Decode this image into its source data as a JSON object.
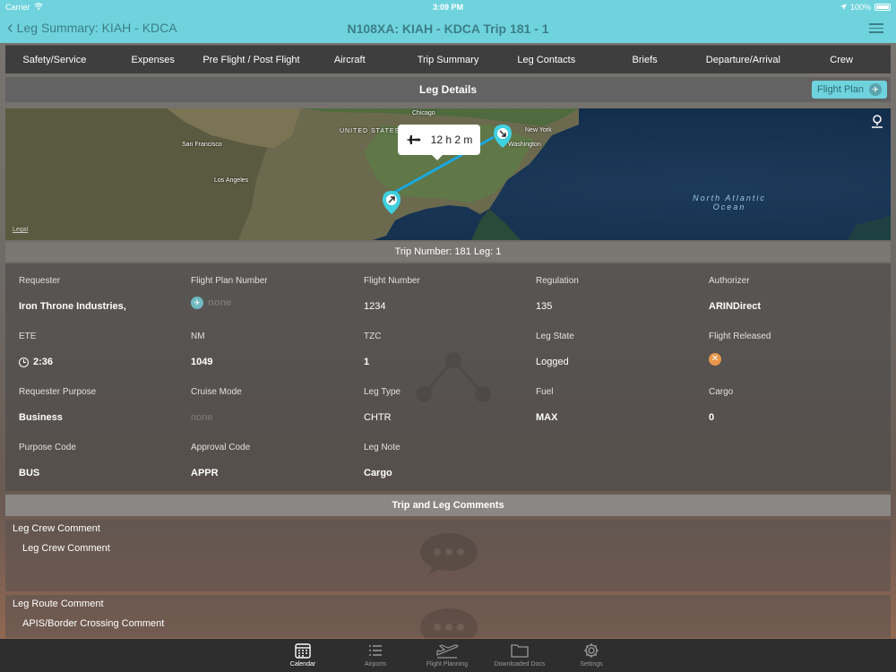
{
  "status": {
    "carrier": "Carrier",
    "time": "3:09 PM",
    "battery": "100%"
  },
  "nav": {
    "back_label": "Leg Summary: KIAH - KDCA",
    "title": "N108XA: KIAH - KDCA  Trip 181 - 1"
  },
  "tabs": [
    "Safety/Service",
    "Expenses",
    "Pre Flight / Post Flight",
    "Aircraft",
    "Trip Summary",
    "Leg Contacts",
    "Briefs",
    "Departure/Arrival",
    "Crew"
  ],
  "leg_details": {
    "title": "Leg Details",
    "flight_plan_label": "Flight Plan"
  },
  "map": {
    "labels": {
      "chicago": "Chicago",
      "san_francisco": "San Francisco",
      "los_angeles": "Los Angeles",
      "new_york": "New York",
      "washington": "Washington",
      "united_states": "UNITED STATES"
    },
    "ocean_line1": "North Atlantic",
    "ocean_line2": "Ocean",
    "duration": "12 h 2 m",
    "legal": "Legal"
  },
  "trip_bar": "Trip Number:  181  Leg:  1",
  "fields": {
    "requester": {
      "label": "Requester",
      "value": "Iron Throne Industries,"
    },
    "flight_plan_number": {
      "label": "Flight Plan Number",
      "value": "none"
    },
    "flight_number": {
      "label": "Flight Number",
      "value": "1234"
    },
    "regulation": {
      "label": "Regulation",
      "value": "135"
    },
    "authorizer": {
      "label": "Authorizer",
      "value": "ARINDirect"
    },
    "ete": {
      "label": "ETE",
      "value": "2:36"
    },
    "nm": {
      "label": "NM",
      "value": "1049"
    },
    "tzc": {
      "label": "TZC",
      "value": "1"
    },
    "leg_state": {
      "label": "Leg State",
      "value": "Logged"
    },
    "flight_released": {
      "label": "Flight Released",
      "value": "✕"
    },
    "requester_purpose": {
      "label": "Requester Purpose",
      "value": "Business"
    },
    "cruise_mode": {
      "label": "Cruise Mode",
      "value": "none"
    },
    "leg_type": {
      "label": "Leg Type",
      "value": "CHTR"
    },
    "fuel": {
      "label": "Fuel",
      "value": "MAX"
    },
    "cargo": {
      "label": "Cargo",
      "value": "0"
    },
    "purpose_code": {
      "label": "Purpose Code",
      "value": "BUS"
    },
    "approval_code": {
      "label": "Approval Code",
      "value": "APPR"
    },
    "leg_note": {
      "label": "Leg Note",
      "value": "Cargo"
    }
  },
  "comments": {
    "header": "Trip and Leg Comments",
    "crew": {
      "title": "Leg Crew Comment",
      "body": "Leg Crew Comment"
    },
    "route": {
      "title": "Leg Route Comment",
      "body": "APIS/Border Crossing Comment"
    }
  },
  "bottom_tabs": [
    "Calendar",
    "Airports",
    "Flight Planning",
    "Downloaded Docs",
    "Settings"
  ],
  "colors": {
    "accent": "#6fd3dd",
    "accent_text": "#3b7f88",
    "route_line": "#1aa8e0",
    "pin": "#3fd0e0",
    "released_badge": "#e8964a"
  }
}
